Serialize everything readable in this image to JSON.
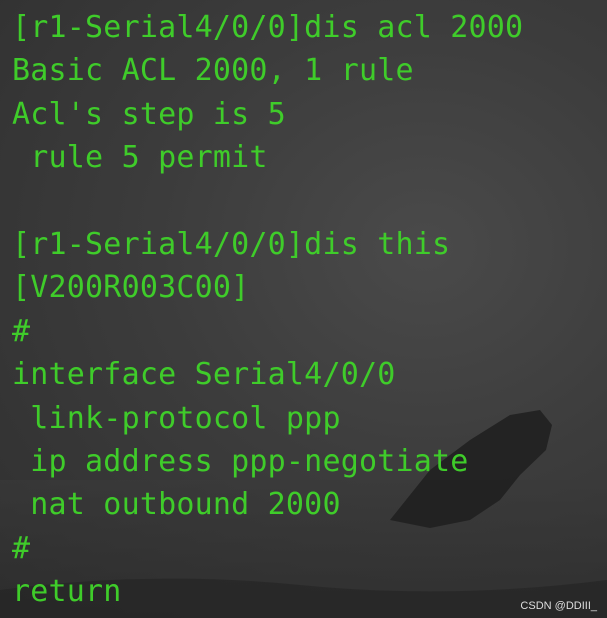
{
  "terminal": {
    "lines": [
      "[r1-Serial4/0/0]dis acl 2000",
      "Basic ACL 2000, 1 rule",
      "Acl's step is 5",
      " rule 5 permit",
      "",
      "[r1-Serial4/0/0]dis this",
      "[V200R003C00]",
      "#",
      "interface Serial4/0/0",
      " link-protocol ppp",
      " ip address ppp-negotiate",
      " nat outbound 2000",
      "#",
      "return"
    ]
  },
  "watermark": "CSDN @DDIII_",
  "colors": {
    "text": "#3fcc2a",
    "background": "#3c3c3c"
  }
}
